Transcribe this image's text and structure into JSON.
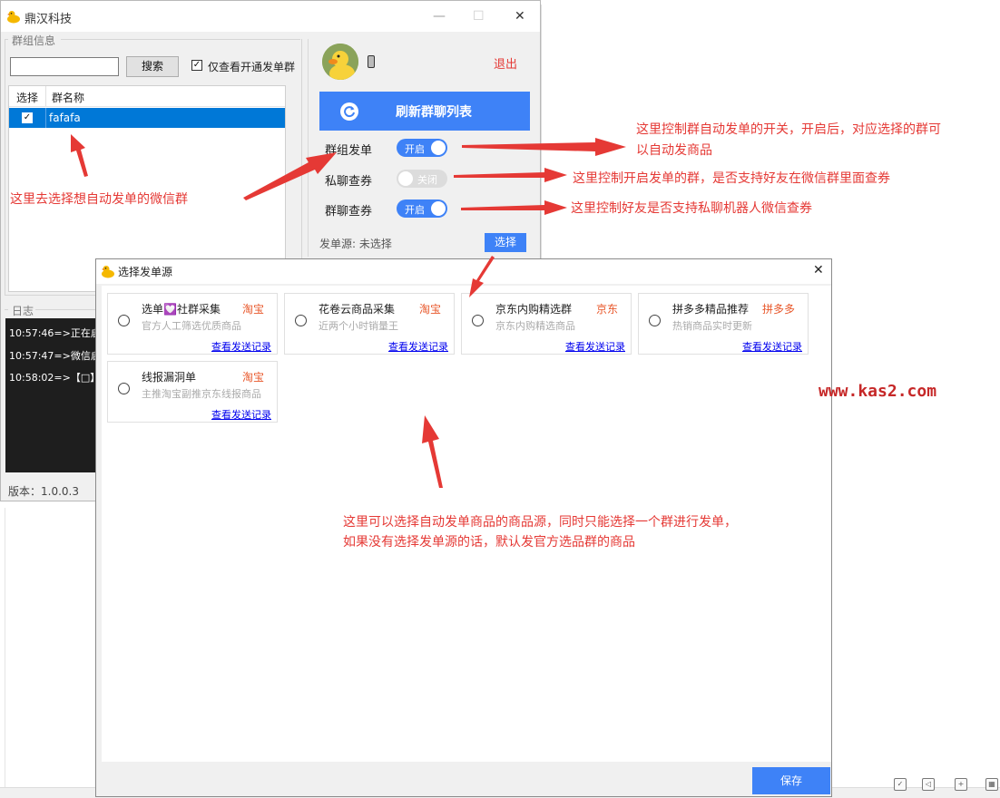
{
  "main_window": {
    "title": "鼎汉科技",
    "minimize": "—",
    "maximize": "☐",
    "close": "✕",
    "group_box_label": "群组信息",
    "search_value": "",
    "search_button": "搜索",
    "only_enabled_checkbox": {
      "label": "仅查看开通发单群",
      "checked": true
    },
    "list_headers": [
      "选择",
      "群名称"
    ],
    "list_rows": [
      {
        "checked": true,
        "name": "fafafa"
      }
    ],
    "log_label": "日志",
    "log_lines": [
      "10:57:46=>正在启",
      "10:57:47=>微信启",
      "10:58:02=>【□】"
    ],
    "version": "版本：1.0.0.3",
    "logout": "退出",
    "refresh_button": "刷新群聊列表",
    "toggles": [
      {
        "label": "群组发单",
        "state": "开启",
        "on": true
      },
      {
        "label": "私聊查券",
        "state": "关闭",
        "on": false
      },
      {
        "label": "群聊查券",
        "state": "开启",
        "on": true
      }
    ],
    "source_label": "发单源: 未选择",
    "select_button": "选择"
  },
  "dialog": {
    "title": "选择发单源",
    "close": "✕",
    "cards": [
      {
        "name": "选单💟社群采集",
        "tag": "淘宝",
        "desc": "官方人工筛选优质商品",
        "link": "查看发送记录"
      },
      {
        "name": "花卷云商品采集",
        "tag": "淘宝",
        "desc": "近两个小时销量王",
        "link": "查看发送记录"
      },
      {
        "name": "京东内购精选群",
        "tag": "京东",
        "desc": "京东内购精选商品",
        "link": "查看发送记录"
      },
      {
        "name": "拼多多精品推荐",
        "tag": "拼多多",
        "desc": "热销商品实时更新",
        "link": "查看发送记录"
      },
      {
        "name": "线报漏洞单",
        "tag": "淘宝",
        "desc": "主推淘宝副推京东线报商品",
        "link": "查看发送记录"
      }
    ],
    "save_button": "保存"
  },
  "annotations": {
    "group_switch": [
      "这里控制群自动发单的开关，开启后，对应选择的群可",
      "以自动发商品"
    ],
    "group_coupon": "这里控制开启发单的群，是否支持好友在微信群里面查券",
    "private_coupon": "这里控制好友是否支持私聊机器人微信查券",
    "select_group": "这里去选择想自动发单的微信群",
    "source": [
      "这里可以选择自动发单商品的商品源，同时只能选择一个群进行发单，",
      "如果没有选择发单源的话，默认发官方选品群的商品"
    ]
  },
  "watermark": "www.kas2.com",
  "colors": {
    "accent": "#3e82f7",
    "annotation": "#e53935",
    "tag": "#e8572a",
    "selection": "#0078d7"
  }
}
